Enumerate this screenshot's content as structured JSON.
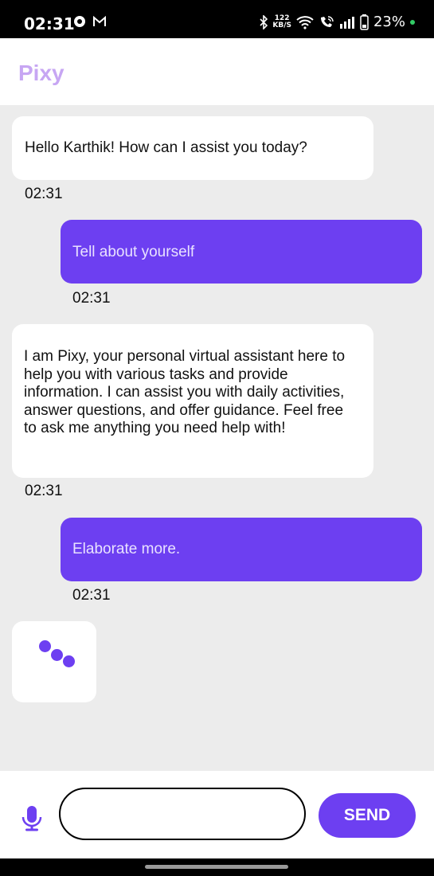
{
  "status_bar": {
    "time": "02:31",
    "net_speed_value": "122",
    "net_speed_unit": "KB/S",
    "battery": "23%"
  },
  "app": {
    "title": "Pixy"
  },
  "messages": [
    {
      "sender": "bot",
      "text": "Hello Karthik! How can I assist you today?",
      "time": "02:31"
    },
    {
      "sender": "user",
      "text": "Tell about yourself",
      "time": "02:31"
    },
    {
      "sender": "bot",
      "text": "I am Pixy, your personal virtual assistant here to help you with various tasks and provide information. I can assist you with daily activities, answer questions, and offer guidance. Feel free to ask me anything you need help with!",
      "time": "02:31"
    },
    {
      "sender": "user",
      "text": "Elaborate more.",
      "time": "02:31"
    }
  ],
  "typing_indicator": {
    "icon": "typing-dots-icon"
  },
  "input": {
    "value": "",
    "placeholder": "",
    "mic_icon": "microphone-icon"
  },
  "send_label": "SEND",
  "colors": {
    "accent": "#6d3ff1",
    "title": "#c7a6f3",
    "background": "#ececec"
  }
}
